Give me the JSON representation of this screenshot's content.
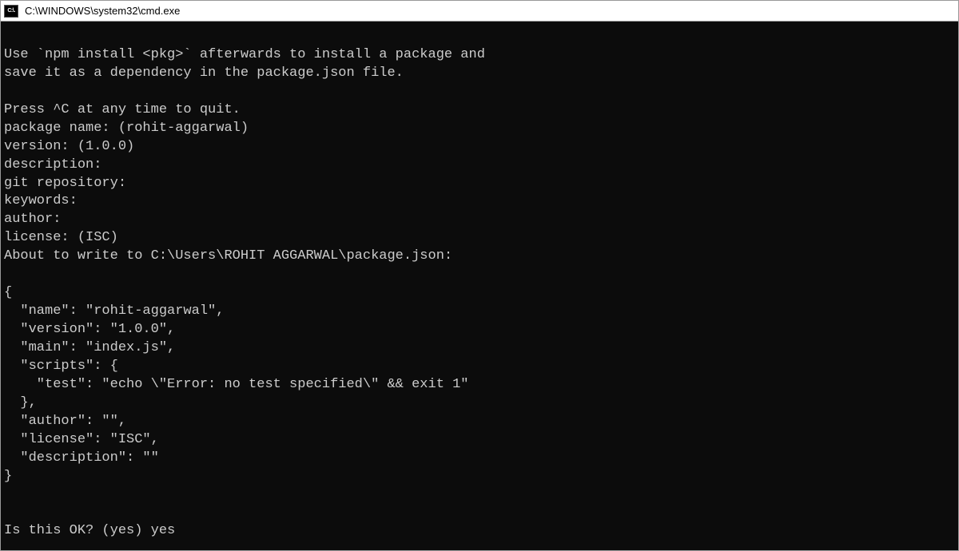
{
  "window": {
    "icon_text": "C:\\.",
    "title": "C:\\WINDOWS\\system32\\cmd.exe"
  },
  "terminal": {
    "lines": {
      "l0": "",
      "l1": "Use `npm install <pkg>` afterwards to install a package and",
      "l2": "save it as a dependency in the package.json file.",
      "l3": "",
      "l4": "Press ^C at any time to quit.",
      "l5": "package name: (rohit-aggarwal)",
      "l6": "version: (1.0.0)",
      "l7": "description:",
      "l8": "git repository:",
      "l9": "keywords:",
      "l10": "author:",
      "l11": "license: (ISC)",
      "l12": "About to write to C:\\Users\\ROHIT AGGARWAL\\package.json:",
      "l13": "",
      "l14": "{",
      "l15": "  \"name\": \"rohit-aggarwal\",",
      "l16": "  \"version\": \"1.0.0\",",
      "l17": "  \"main\": \"index.js\",",
      "l18": "  \"scripts\": {",
      "l19": "    \"test\": \"echo \\\"Error: no test specified\\\" && exit 1\"",
      "l20": "  },",
      "l21": "  \"author\": \"\",",
      "l22": "  \"license\": \"ISC\",",
      "l23": "  \"description\": \"\"",
      "l24": "}",
      "l25": "",
      "l26": "",
      "l27": "Is this OK? (yes) yes"
    }
  }
}
